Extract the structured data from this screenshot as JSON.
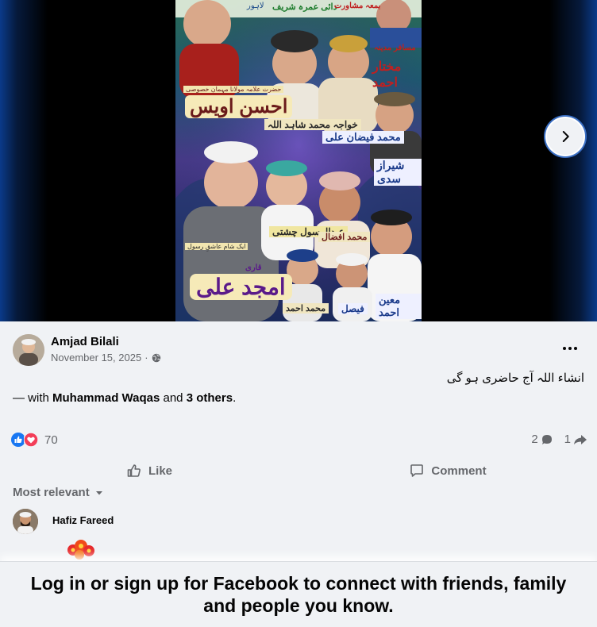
{
  "media": {
    "next_button_label": "Next photo",
    "next_icon": "chevron-right-icon",
    "poster_text": {
      "top_left": "لاہور",
      "top_center": "دائی عمرہ شریف",
      "top_right": "بمعہ مشاورت",
      "guest_1_title": "مسافر مدینہ",
      "guest_1_name": "مختار احمد",
      "guest_2_title": "حضرت علامہ مولانا مہمان خصوصی",
      "guest_2_name": "احسن اویس",
      "guest_3_name": "خواجہ محمد شاہد اللہ",
      "guest_4_name": "محمد فیضان علی",
      "guest_5_name": "شیراز سدی",
      "guest_6_name": "عبدالرسول چشتی",
      "guest_7_name": "محمد افضال",
      "guest_8_title": "ایک شام عاشقِ رسول",
      "guest_8_name": "امجد علی",
      "guest_8_prefix": "قاری",
      "guest_9_name": "محمد احمد",
      "guest_10_name": "فیصل",
      "guest_11_name": "معین احمد"
    }
  },
  "post": {
    "author": "Amjad Bilali",
    "date": "November 15, 2025",
    "separator": "·",
    "privacy_icon": "globe-icon",
    "more_icon": "more-options-icon",
    "text": "انشاء اللہ آج حاضری ہو گی",
    "tagged": {
      "prefix": "— with",
      "person": "Muhammad Waqas",
      "conj": "and",
      "others": "3 others",
      "suffix": "."
    },
    "reactions": {
      "icons": [
        "like-reaction-icon",
        "love-reaction-icon"
      ],
      "count": "70"
    },
    "comments_count": "2",
    "shares_count": "1",
    "like_label": "Like",
    "comment_label": "Comment",
    "sort_label": "Most relevant",
    "comment": {
      "author": "Hafiz Fareed"
    }
  },
  "login_banner": {
    "text": "Log in or sign up for Facebook to connect with friends, family and people you know."
  },
  "colors": {
    "accent": "#1877f2",
    "love": "#f33e58",
    "muted": "#65676b",
    "background": "#f0f2f5"
  }
}
